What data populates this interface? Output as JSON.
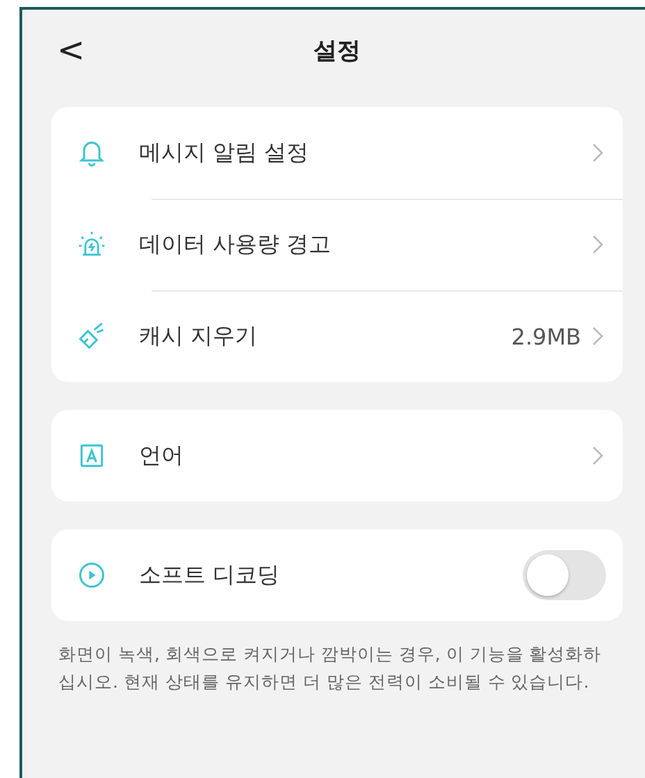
{
  "header": {
    "back": "<",
    "title": "설정"
  },
  "groups": [
    {
      "items": [
        {
          "kind": "link",
          "label": "메시지 알림 설정"
        },
        {
          "kind": "link",
          "label": "데이터 사용량 경고"
        },
        {
          "kind": "value",
          "label": "캐시 지우기",
          "value": "2.9MB"
        }
      ]
    },
    {
      "items": [
        {
          "kind": "link",
          "label": "언어"
        }
      ]
    },
    {
      "items": [
        {
          "kind": "toggle",
          "label": "소프트 디코딩",
          "on": false
        }
      ]
    }
  ],
  "note": "화면이 녹색, 회색으로 켜지거나 깜박이는 경우, 이 기능을 활성화하십시오. 현재 상태를 유지하면 더 많은 전력이 소비될 수 있습니다."
}
